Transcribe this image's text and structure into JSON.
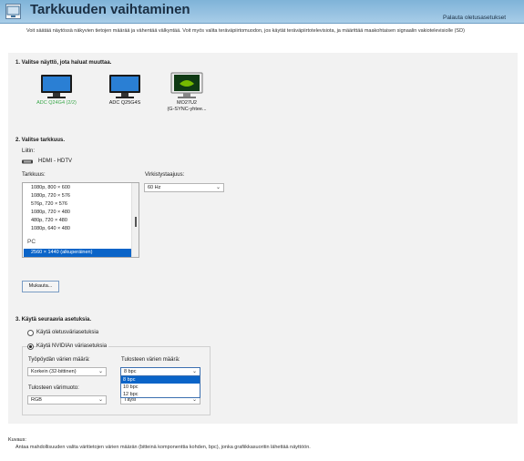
{
  "header": {
    "title": "Tarkkuuden vaihtaminen",
    "reset_label": "Palauta oletusasetukset"
  },
  "intro": "Voit säätää näytössä näkyvien tietojen määrää ja vähentää välkyntää. Voit myös valita teräväpiirtomuodon, jos käytät teräväpiirtotelevisiota, ja määrittää maakohtaisen signaalin vakiotelevisiolle (SD)",
  "section1": {
    "title": "1. Valitse näyttö, jota haluat muuttaa.",
    "monitors": [
      {
        "label": "ADC Q24G4 (2/2)",
        "selected": true
      },
      {
        "label": "ADC Q25G4S",
        "selected": false
      },
      {
        "label": "MO27U2",
        "label2": "(G-SYNC-yhtee...",
        "selected": false
      }
    ]
  },
  "section2": {
    "title": "2. Valitse tarkkuus.",
    "connector_label": "Liitin:",
    "connector_value": "HDMI - HDTV",
    "resolution_label": "Tarkkuus:",
    "refresh_label": "Virkistystaajuus:",
    "refresh_value": "60 Hz",
    "resolutions": [
      "1080p, 800 × 600",
      "1080p, 720 × 576",
      "576p, 720 × 576",
      "1080p, 720 × 480",
      "480p, 720 × 480",
      "1080p, 640 × 480"
    ],
    "group_pc": "PC",
    "selected_resolution": "2560 × 1440 (alkuperäinen)",
    "custom_button": "Mukauta..."
  },
  "section3": {
    "title": "3. Käytä seuraavia asetuksia.",
    "radio_default": "Käytä oletusväriasetuksia",
    "radio_nvidia": "Käytä NVIDIAn väriasetuksia",
    "desktop_depth_label": "Työpöydän värien määrä:",
    "desktop_depth_value": "Korkein (32-bittinen)",
    "output_depth_label": "Tulosteen värien määrä:",
    "output_depth_value": "8 bpc",
    "output_depth_options": [
      "8 bpc",
      "10 bpc",
      "12 bpc"
    ],
    "output_format_label": "Tulosteen värimuoto:",
    "output_format_value": "RGB",
    "output_range_value": "Täysi"
  },
  "description": {
    "title": "Kuvaus:",
    "text": "Antaa mahdollisuuden valita väritietojen värien määrän (bitteinä komponenttia kohden, bpc), jonka grafiikkasuoritin lähettää näyttöön."
  },
  "colors": {
    "accent": "#0a64c8",
    "selected_monitor_label": "#3aa84a",
    "header_bg": "#8fbde0"
  }
}
